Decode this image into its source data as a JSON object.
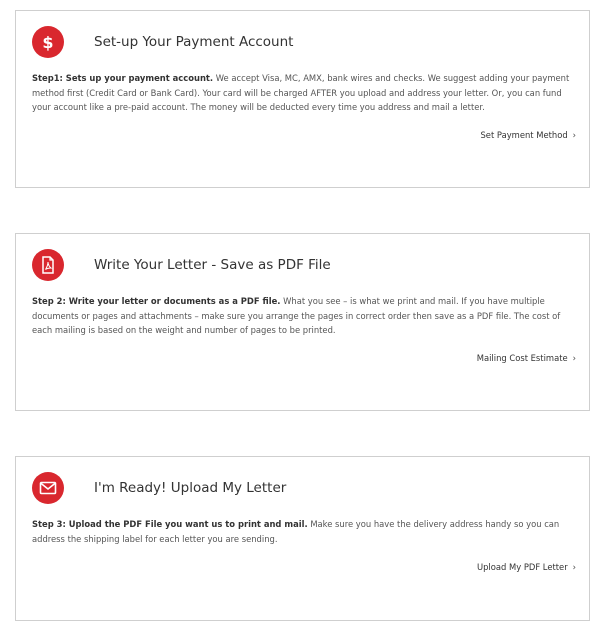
{
  "steps": [
    {
      "icon": "dollar-icon",
      "title": "Set-up Your Payment Account",
      "desc_bold": "Step1: Sets up your payment account.",
      "desc_rest": " We accept Visa, MC, AMX, bank wires and checks.  We suggest adding your payment method first (Credit Card or Bank Card).  Your card will be charged AFTER you upload and address your letter.  Or, you can fund your account like a pre-paid account.  The money will be deducted every time you address and mail a letter.",
      "link": "Set Payment Method"
    },
    {
      "icon": "pdf-file-icon",
      "title": "Write Your Letter - Save as PDF File",
      "desc_bold": "Step 2: Write your letter or documents as a PDF file.",
      "desc_rest": "  What you see – is what we print and mail.  If you have multiple documents or pages and attachments –  make sure you arrange the pages in correct order then save as a PDF file.  The cost of each mailing is based on the weight and number of pages to be printed.",
      "link": "Mailing Cost Estimate"
    },
    {
      "icon": "envelope-icon",
      "title": "I'm Ready! Upload My Letter",
      "desc_bold": "Step 3:  Upload the PDF File you want us to print and mail.",
      "desc_rest": "  Make sure you have the delivery address handy so you can address the shipping label for each letter you are sending.",
      "link": "Upload My PDF Letter"
    }
  ],
  "chevron": "›",
  "colors": {
    "accent": "#d9272e",
    "border": "#cfcfcf",
    "text": "#333333"
  }
}
